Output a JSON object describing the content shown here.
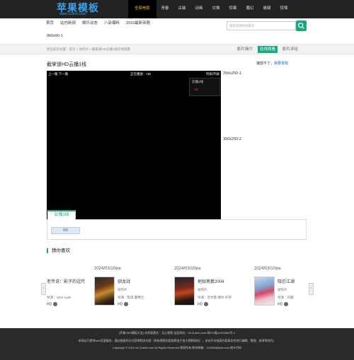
{
  "header": {
    "logo_text": "苹果模板",
    "logo_url": "www.11dmh.com",
    "nav": [
      "全部电影",
      "青春",
      "古装",
      "动画",
      "灾难",
      "惊案",
      "魔幻",
      "悬疑",
      "惊悚"
    ],
    "nav_active": 0
  },
  "subnav": {
    "items": [
      "首页",
      "站内新闻",
      "娱乐动态",
      "八卦爆料",
      "2015最新亲剧"
    ]
  },
  "search": {
    "placeholder": "搜索您想找的影片"
  },
  "ad_top": "960x90-1",
  "breadcrumb": "您当前的位置：首页 » 动作片 » 截掌道HD云播1线在线观看",
  "tabs": [
    "影片简介",
    "在线观看",
    "影片评论"
  ],
  "tabs_active": 1,
  "video_title": "截掌道HD云播1线",
  "player": {
    "prev_next": "上一集  下一集",
    "now_playing": "正在播放：HD",
    "episodes": "列表/列表",
    "menu_title": "云播1线",
    "menu_item": "HD"
  },
  "ads_side": [
    "250x250-1",
    "300x250-2"
  ],
  "report": {
    "text": "播放不了，",
    "link": "我要报错"
  },
  "source_tab": "云播1线",
  "episode_button": "HD",
  "recommend_title": "猜你喜欢",
  "carousel": {
    "prev": "‹",
    "next": "›",
    "cards": [
      {
        "date": "",
        "date_suffix": "",
        "title": "老传说：影子的诅咒",
        "category": "",
        "actor": "导演：John Lyde",
        "hd": "HD"
      },
      {
        "date": "2024/03/10",
        "date_suffix": "更新",
        "title": "驯龙战",
        "category": "动作片",
        "actor": "导演：陈思 霍特兰",
        "hd": "HD"
      },
      {
        "date": "2024/03/10",
        "date_suffix": "更新",
        "title": "地狱男爵2004",
        "category": "动作片",
        "actor": "导演：吉尔莫·德尔·托罗",
        "hd": "HD"
      },
      {
        "date": "2024/03/10",
        "date_suffix": "更新",
        "title": "隐忍江湖",
        "category": "动作片",
        "actor": "导演：司德",
        "hd": "HD"
      }
    ]
  },
  "footer": {
    "line1": "[苹果CMS模板大全] 本资源源名：无心视频 运征网站：v8.11dmh.com 网ICP备11002865号-2",
    "line2": "本网站只提供web页面服务，通过链接的方式获得相关内容（所有视频内容由爬虫于各大视频网站）。本站不对链接内容真实性进行编辑、整理、修改等权利。",
    "line3": "Copyright © 2015 v8.11dmh.com All Rights Reserved 版权所有 联系邮箱：123456@test.com 统计代码"
  },
  "colors": {
    "accent": "#1ba784",
    "topbar": "#222222",
    "active_nav_text": "#e8c800",
    "footer": "#2a2a2a"
  }
}
